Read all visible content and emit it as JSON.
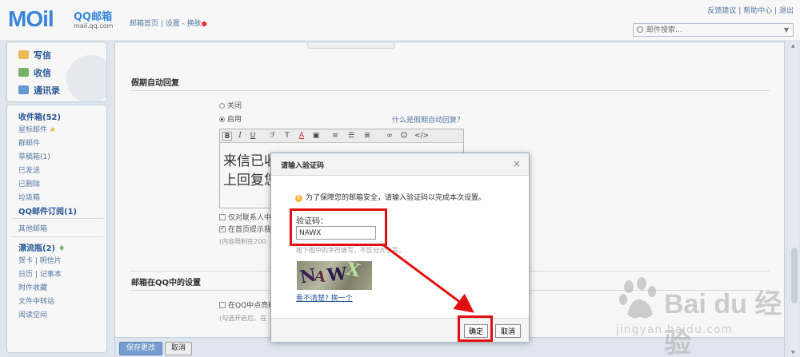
{
  "header": {
    "logo_main": "MOil",
    "logo_qq": "QQ邮箱",
    "logo_url": "mail.qq.com",
    "nav_home": "邮箱首页",
    "nav_settings": "设置",
    "nav_skin": "换肤",
    "link_feedback": "反馈建议",
    "link_help": "帮助中心",
    "link_logout": "退出",
    "search_placeholder": "邮件搜索..."
  },
  "sidebar": {
    "write": "写信",
    "inbox": "收信",
    "contacts": "通讯录",
    "folders": [
      {
        "label": "收件箱(52)",
        "bold": true
      },
      {
        "label": "星标邮件"
      },
      {
        "label": "群邮件"
      },
      {
        "label": "草稿箱(1)"
      },
      {
        "label": "已发送"
      },
      {
        "label": "已删除"
      },
      {
        "label": "垃圾箱"
      },
      {
        "label": "QQ邮件订阅(1)",
        "bold": true
      },
      {
        "label": "其他邮箱"
      },
      {
        "label": "漂流瓶(2)",
        "bold": true
      },
      {
        "label": "贺卡 | 明信片"
      },
      {
        "label": "日历 | 记事本"
      },
      {
        "label": "附件收藏"
      },
      {
        "label": "文件中转站"
      },
      {
        "label": "阅读空间"
      }
    ]
  },
  "main": {
    "section1_title": "假期自动回复",
    "radio_off": "关闭",
    "radio_on": "启用",
    "help_link": "什么是假期自动回复？",
    "editor_line1": "来信已收",
    "editor_line2": "上回复您",
    "chk_contacts_only": "仅对联系人中",
    "chk_homepage": "在首页提示我",
    "limit_hint": "(内容限制在200",
    "section2_title": "邮箱在QQ中的设置",
    "chk_qq": "在QQ中点亮邮",
    "qq_hint": "(勾选开启后，在",
    "save_button": "保存更改",
    "cancel_button": "取消"
  },
  "dialog": {
    "title": "请输入验证码",
    "close": "×",
    "warning": "为了保障您的邮箱安全，请输入验证码以完成本次设置。",
    "code_label": "验证码：",
    "code_value": "NAWX",
    "hint": "按下图中的字符填写，不区分大小写。",
    "captcha_text": "NAWX",
    "refresh_link": "看不清楚? 换一个",
    "ok_button": "确定",
    "cancel_button": "取消"
  },
  "watermark": {
    "brand": "Bai du 经验",
    "url": "jingyan.baidu.com"
  },
  "colors": {
    "accent": "#3b8be0",
    "highlight_red": "#e01010",
    "link": "#5a7ca8"
  }
}
